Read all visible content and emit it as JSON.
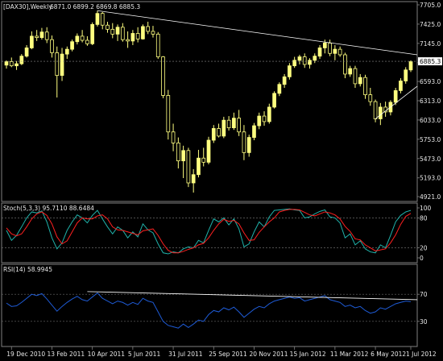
{
  "header": {
    "symbol_timeframe": "[DAX30],Weekly",
    "ohlc": "6871.0 6899.2 6869.8 6885.3"
  },
  "colors": {
    "background": "#000000",
    "frame": "#808080",
    "bull_candle": "#ffff80",
    "bear_candle": "#000000",
    "candle_outline": "#ffff80",
    "trendline": "#ffffff",
    "price_line": "#8a8a8a",
    "stoch_main": "#20b2aa",
    "stoch_signal": "#ff2020",
    "rsi": "#1e5bd6",
    "level_line": "#6a6a6a",
    "text": "#e8e8e8",
    "price_tag_bg": "#ffffff",
    "price_tag_text": "#000000"
  },
  "chart_data": [
    {
      "type": "candlestick",
      "panel": "price",
      "ylim": [
        4921.0,
        7705.0
      ],
      "y_ticks": [
        "7705.0",
        "7425.0",
        "7145.0",
        "6865.3",
        "6593.0",
        "6313.0",
        "6033.0",
        "5753.0",
        "5473.0",
        "5193.0",
        "4921.0"
      ],
      "current_price": "6885.3",
      "x_ticks": [
        "19 Dec 2010",
        "13 Feb 2011",
        "10 Apr 2011",
        "5 Jun 2011",
        "31 Jul 2011",
        "25 Sep 2011",
        "20 Nov 2011",
        "15 Jan 2012",
        "11 Mar 2012",
        "6 May 2012",
        "1 Jul 2012"
      ],
      "candles": [
        [
          6830,
          6900,
          6780,
          6880
        ],
        [
          6880,
          6940,
          6800,
          6820
        ],
        [
          6820,
          6890,
          6760,
          6850
        ],
        [
          6850,
          6990,
          6830,
          6960
        ],
        [
          6960,
          7120,
          6940,
          7080
        ],
        [
          7080,
          7320,
          7060,
          7250
        ],
        [
          7250,
          7340,
          7180,
          7230
        ],
        [
          7230,
          7370,
          7200,
          7310
        ],
        [
          7310,
          7380,
          7150,
          7200
        ],
        [
          7200,
          7260,
          6940,
          7010
        ],
        [
          7010,
          7100,
          6360,
          6680
        ],
        [
          6680,
          7080,
          6600,
          6990
        ],
        [
          6990,
          7100,
          6920,
          7060
        ],
        [
          7060,
          7200,
          7030,
          7170
        ],
        [
          7170,
          7290,
          7130,
          7250
        ],
        [
          7250,
          7340,
          7160,
          7190
        ],
        [
          7190,
          7250,
          7110,
          7140
        ],
        [
          7140,
          7450,
          7120,
          7420
        ],
        [
          7420,
          7620,
          7390,
          7580
        ],
        [
          7580,
          7600,
          7350,
          7410
        ],
        [
          7410,
          7460,
          7300,
          7350
        ],
        [
          7350,
          7440,
          7220,
          7280
        ],
        [
          7280,
          7420,
          7180,
          7380
        ],
        [
          7380,
          7440,
          7170,
          7200
        ],
        [
          7200,
          7320,
          7080,
          7180
        ],
        [
          7180,
          7340,
          7120,
          7290
        ],
        [
          7290,
          7380,
          7160,
          7210
        ],
        [
          7210,
          7420,
          7200,
          7390
        ],
        [
          7390,
          7460,
          7280,
          7320
        ],
        [
          7320,
          7400,
          7230,
          7280
        ],
        [
          7280,
          7310,
          6920,
          6950
        ],
        [
          6950,
          6960,
          6350,
          6390
        ],
        [
          6390,
          6470,
          5750,
          5860
        ],
        [
          5860,
          5980,
          5580,
          5700
        ],
        [
          5700,
          5780,
          5330,
          5440
        ],
        [
          5440,
          5660,
          5190,
          5590
        ],
        [
          5590,
          5630,
          5060,
          5120
        ],
        [
          5120,
          5320,
          4980,
          5240
        ],
        [
          5240,
          5600,
          5200,
          5480
        ],
        [
          5480,
          5630,
          5360,
          5420
        ],
        [
          5420,
          5790,
          5390,
          5740
        ],
        [
          5740,
          5960,
          5700,
          5910
        ],
        [
          5910,
          5980,
          5780,
          5800
        ],
        [
          5800,
          6080,
          5770,
          6030
        ],
        [
          6030,
          6090,
          5880,
          5920
        ],
        [
          5920,
          6140,
          5890,
          6060
        ],
        [
          6060,
          6180,
          5800,
          5860
        ],
        [
          5860,
          5960,
          5450,
          5560
        ],
        [
          5560,
          5820,
          5500,
          5780
        ],
        [
          5780,
          5990,
          5740,
          5950
        ],
        [
          5950,
          6140,
          5900,
          6090
        ],
        [
          6090,
          6160,
          5950,
          6010
        ],
        [
          6010,
          6270,
          5980,
          6220
        ],
        [
          6220,
          6450,
          6200,
          6420
        ],
        [
          6420,
          6580,
          6380,
          6550
        ],
        [
          6550,
          6700,
          6500,
          6660
        ],
        [
          6660,
          6860,
          6620,
          6820
        ],
        [
          6820,
          6950,
          6790,
          6900
        ],
        [
          6900,
          6980,
          6840,
          6950
        ],
        [
          6950,
          7000,
          6790,
          6840
        ],
        [
          6840,
          6930,
          6780,
          6900
        ],
        [
          6900,
          7000,
          6860,
          6960
        ],
        [
          6960,
          7120,
          6920,
          7080
        ],
        [
          7080,
          7200,
          7000,
          7150
        ],
        [
          7150,
          7200,
          6960,
          7000
        ],
        [
          7000,
          7120,
          6900,
          7060
        ],
        [
          7060,
          7100,
          6950,
          6980
        ],
        [
          6980,
          7010,
          6640,
          6700
        ],
        [
          6700,
          6820,
          6660,
          6780
        ],
        [
          6780,
          6820,
          6500,
          6560
        ],
        [
          6560,
          6700,
          6520,
          6650
        ],
        [
          6650,
          6690,
          6340,
          6400
        ],
        [
          6400,
          6500,
          6240,
          6300
        ],
        [
          6300,
          6330,
          6000,
          6050
        ],
        [
          6050,
          6280,
          5960,
          6220
        ],
        [
          6220,
          6300,
          6080,
          6150
        ],
        [
          6150,
          6320,
          6100,
          6290
        ],
        [
          6290,
          6500,
          6250,
          6460
        ],
        [
          6460,
          6640,
          6420,
          6600
        ],
        [
          6600,
          6800,
          6560,
          6760
        ],
        [
          6760,
          6900,
          6730,
          6880
        ]
      ],
      "trendlines": [
        {
          "from": [
            18,
            7620
          ],
          "to": [
            80,
            6980
          ]
        },
        {
          "from": [
            73,
            6050
          ],
          "to": [
            80,
            6500
          ]
        }
      ]
    },
    {
      "type": "line",
      "panel": "stochastic",
      "indicator_label": "Stoch(5,3,3) 95.7110 88.6484",
      "ylim": [
        0,
        100
      ],
      "levels": [
        20,
        80
      ],
      "y_ticks": [
        "100",
        "80",
        "20",
        "0"
      ],
      "series": [
        {
          "name": "main",
          "values": [
            55,
            35,
            45,
            62,
            80,
            92,
            90,
            94,
            72,
            40,
            18,
            30,
            55,
            72,
            86,
            80,
            70,
            85,
            95,
            78,
            62,
            48,
            62,
            55,
            40,
            52,
            42,
            68,
            56,
            50,
            28,
            10,
            8,
            12,
            10,
            18,
            22,
            20,
            35,
            30,
            55,
            78,
            72,
            80,
            66,
            78,
            58,
            22,
            28,
            52,
            72,
            62,
            82,
            95,
            96,
            97,
            98,
            96,
            95,
            80,
            82,
            88,
            93,
            96,
            82,
            80,
            70,
            40,
            48,
            26,
            34,
            18,
            12,
            10,
            26,
            20,
            45,
            72,
            85,
            92,
            95
          ]
        },
        {
          "name": "signal",
          "values": [
            60,
            48,
            44,
            48,
            62,
            78,
            88,
            92,
            85,
            68,
            42,
            28,
            34,
            52,
            70,
            80,
            78,
            78,
            84,
            86,
            78,
            62,
            56,
            55,
            52,
            49,
            46,
            54,
            56,
            58,
            45,
            28,
            15,
            10,
            10,
            13,
            17,
            20,
            26,
            29,
            40,
            55,
            68,
            77,
            73,
            75,
            68,
            50,
            35,
            36,
            51,
            62,
            72,
            80,
            92,
            95,
            97,
            97,
            96,
            91,
            86,
            84,
            88,
            92,
            90,
            86,
            78,
            63,
            53,
            38,
            36,
            26,
            20,
            14,
            16,
            18,
            30,
            46,
            67,
            83,
            89
          ]
        }
      ]
    },
    {
      "type": "line",
      "panel": "rsi",
      "indicator_label": "RSI(14) 58.9945",
      "ylim": [
        0,
        100
      ],
      "levels": [
        30,
        70
      ],
      "y_ticks": [
        "70",
        "30"
      ],
      "series": [
        {
          "name": "RSI",
          "values": [
            57,
            52,
            53,
            58,
            64,
            70,
            68,
            71,
            63,
            54,
            45,
            52,
            58,
            63,
            67,
            62,
            60,
            66,
            72,
            64,
            60,
            56,
            60,
            58,
            54,
            58,
            55,
            64,
            60,
            58,
            44,
            30,
            24,
            22,
            20,
            26,
            21,
            26,
            32,
            30,
            40,
            46,
            44,
            50,
            47,
            51,
            44,
            36,
            42,
            48,
            52,
            50,
            56,
            60,
            62,
            64,
            66,
            64,
            65,
            60,
            62,
            64,
            66,
            68,
            62,
            60,
            58,
            52,
            54,
            50,
            52,
            46,
            42,
            44,
            50,
            48,
            52,
            56,
            58,
            60,
            59
          ]
        }
      ],
      "trendline": {
        "from": [
          16,
          74
        ],
        "to": [
          80,
          62
        ]
      }
    }
  ]
}
